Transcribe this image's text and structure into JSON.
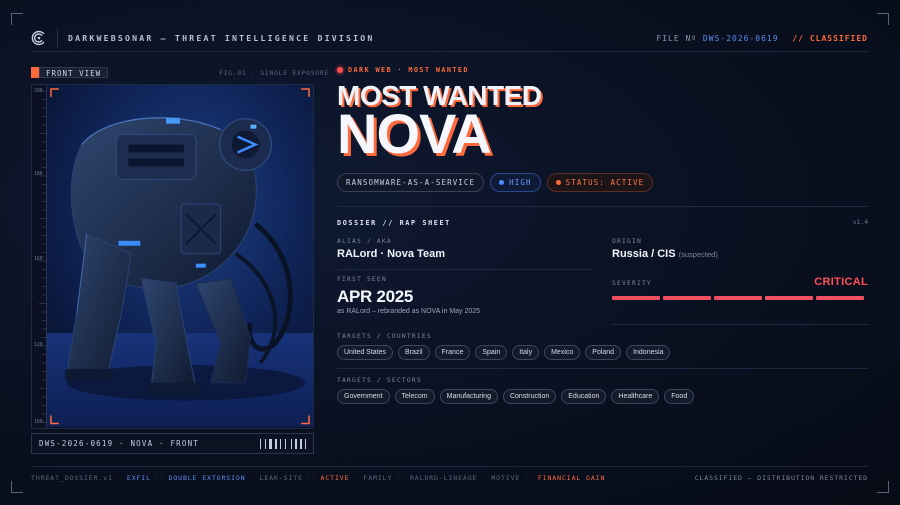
{
  "header": {
    "brand": "DARKWEBSONAR — THREAT INTELLIGENCE DIVISION",
    "file_prefix": "FILE Nº",
    "file_id": "DWS-2026-0619",
    "classification": "// CLASSIFIED"
  },
  "photo": {
    "view_tag": "FRONT VIEW",
    "fig_label": "FIG.01 · SINGLE EXPOSURE",
    "ruler_labels": [
      "200",
      "180",
      "160",
      "140",
      "120",
      "100"
    ],
    "caption": "DWS-2026-0619 · NOVA · FRONT"
  },
  "hero": {
    "alert": "DARK WEB · MOST WANTED",
    "title_line1": "MOST WANTED",
    "title_line2": "NOVA"
  },
  "chips": {
    "category": "RANSOMWARE-AS-A-SERVICE",
    "level": "HIGH",
    "status": "STATUS: ACTIVE"
  },
  "dossier": {
    "heading": "DOSSIER // RAP SHEET",
    "version": "v1.4",
    "alias_label": "ALIAS / AKA",
    "alias_value": "RALord · Nova Team",
    "origin_label": "ORIGIN",
    "origin_value": "Russia / CIS",
    "origin_note": "(suspected)",
    "first_seen_label": "FIRST SEEN",
    "first_seen_value": "APR 2025",
    "first_seen_note": "as RALord – rebranded as NOVA in May 2025",
    "severity_label": "SEVERITY",
    "severity_value": "CRITICAL",
    "severity_level": 5,
    "severity_max": 5
  },
  "targets": {
    "countries_label": "TARGETS / COUNTRIES",
    "countries": [
      "United States",
      "Brazil",
      "France",
      "Spain",
      "Italy",
      "Mexico",
      "Poland",
      "Indonesia"
    ],
    "sectors_label": "TARGETS / SECTORS",
    "sectors": [
      "Government",
      "Telecom",
      "Manufacturing",
      "Construction",
      "Education",
      "Healthcare",
      "Food"
    ]
  },
  "footer": {
    "doc": "THREAT_DOSSIER.v1",
    "exfil_k": "EXFIL",
    "exfil_v": "DOUBLE EXTORSION",
    "leak_k": "LEAK-SITE",
    "leak_v": "ACTIVE",
    "family_k": "FAMILY",
    "family_v": "RALORD-LINEAGE",
    "motive_k": "MOTIVE",
    "motive_v": "FINANCIAL GAIN",
    "sep": "··",
    "restricted": "CLASSIFIED — DISTRIBUTION RESTRICTED"
  },
  "colors": {
    "accent_orange": "#ff6a3c",
    "accent_blue": "#5b8ef0",
    "critical_red": "#ff4f57",
    "background": "#0a1020"
  }
}
